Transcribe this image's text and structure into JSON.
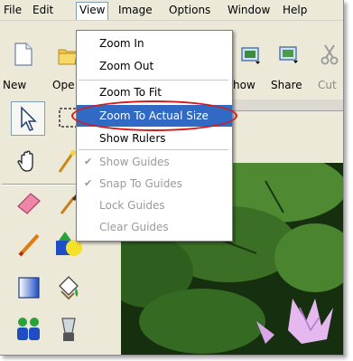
{
  "menu": {
    "items": [
      {
        "key": "file",
        "label": "File"
      },
      {
        "key": "edit",
        "label": "Edit"
      },
      {
        "key": "view",
        "label": "View"
      },
      {
        "key": "image",
        "label": "Image"
      },
      {
        "key": "options",
        "label": "Options"
      },
      {
        "key": "window",
        "label": "Window"
      },
      {
        "key": "help",
        "label": "Help"
      }
    ],
    "active": "View"
  },
  "toolbar": {
    "new_label": "New",
    "open_label": "Ope",
    "show_label": "how",
    "share_label": "Share",
    "cut_label": "Cut"
  },
  "view_menu": {
    "zoom_in": "Zoom In",
    "zoom_out": "Zoom Out",
    "zoom_to_fit": "Zoom To Fit",
    "zoom_actual": "Zoom To Actual Size",
    "show_rulers": "Show Rulers",
    "show_guides": "Show Guides",
    "snap_to_guides": "Snap To Guides",
    "lock_guides": "Lock Guides",
    "clear_guides": "Clear Guides",
    "highlighted": "Zoom To Actual Size",
    "checked": [
      "Show Guides",
      "Snap To Guides"
    ],
    "disabled": [
      "Show Guides",
      "Snap To Guides",
      "Lock Guides",
      "Clear Guides"
    ]
  },
  "colors": {
    "chrome": "#ece9d8",
    "highlight": "#316ac5",
    "annotation_ring": "#d21a1a",
    "disabled_text": "#9a9a9a"
  },
  "icons": [
    "new-document-icon",
    "open-folder-icon",
    "slideshow-icon",
    "share-icon",
    "cut-icon",
    "arrow-pointer-icon",
    "marquee-select-icon",
    "hand-pan-icon",
    "magic-wand-icon",
    "eraser-icon",
    "brush-icon",
    "pencil-icon",
    "shapes-icon",
    "gradient-icon",
    "paint-bucket-icon",
    "clone-people-icon",
    "blender-icon"
  ]
}
